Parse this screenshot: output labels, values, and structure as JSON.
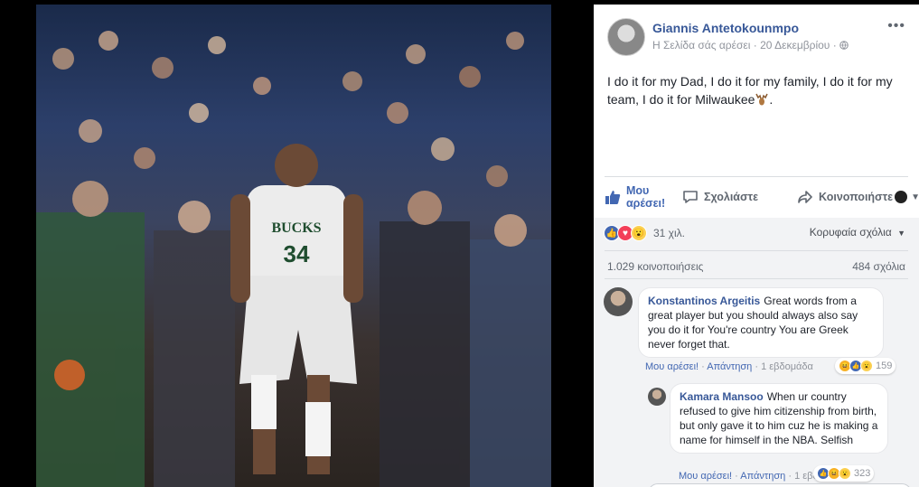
{
  "post": {
    "author": "Giannis Antetokounmpo",
    "liked_page": "Η Σελίδα σάς αρέσει",
    "separator": "·",
    "date": "20 Δεκεμβρίου",
    "privacy_icon": "globe-icon",
    "text": "I do it for my Dad, I do it for my family, I do it for my team, I do it for Milwaukee",
    "text_emoji_icon": "deer-icon",
    "text_end": ".",
    "more_icon": "more-options-icon"
  },
  "photo": {
    "jersey_team": "BUCKS",
    "jersey_number": "34"
  },
  "actions": {
    "like_line1": "Μου",
    "like_line2": "αρέσει!",
    "comment": "Σχολιάστε",
    "share": "Κοινοποιήστε"
  },
  "stats": {
    "reactions_count": "31 χιλ.",
    "top_comments": "Κορυφαία σχόλια",
    "shares": "1.029 κοινοποιήσεις",
    "comments": "484 σχόλια"
  },
  "comments": [
    {
      "author": "Konstantinos Argeitis",
      "text": "Great words from a great player but you should always also say you do it for You're country You are Greek never forget that.",
      "like": "Μου αρέσει!",
      "reply": "Απάντηση",
      "time": "1 εβδομάδα",
      "reactions": "159",
      "dot": "·"
    },
    {
      "author": "Kamara Mansoo",
      "text": "When ur country refused to give him citizenship from birth, but only gave it to him cuz he is making a name for himself in the NBA. Selfish",
      "like": "Μου αρέσει!",
      "reply": "Απάντηση",
      "time": "1 εβδομάδα",
      "reactions": "323",
      "dot": "·"
    }
  ],
  "colors": {
    "fb_blue": "#4267b2",
    "link_blue": "#385898",
    "panel_bg": "#ffffff",
    "gray_bg": "#f2f3f5"
  }
}
